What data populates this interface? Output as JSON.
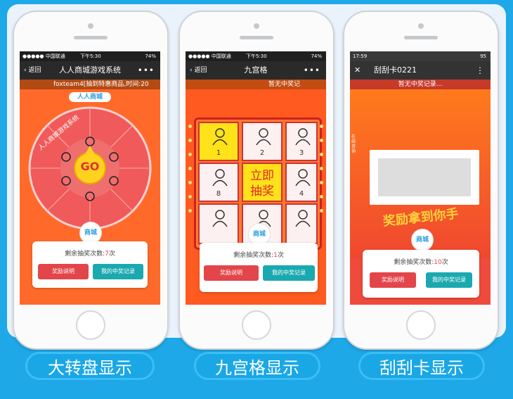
{
  "phones": [
    {
      "status": {
        "carrier": "●●●●● 中国联通",
        "time": "下午5:30",
        "battery": "74%"
      },
      "nav": {
        "back": "返回",
        "title": "人人商城游戏系统",
        "more": "•••"
      },
      "marquee": "foxteam4[抽到特惠商品,时间:20",
      "header_logo": "人人商城",
      "wheel": {
        "center": "GO",
        "ring_text": "人人商城游戏系统"
      },
      "logo": "商城",
      "remaining_prefix": "剩余抽奖次数:",
      "remaining_value": "7",
      "remaining_suffix": "次",
      "btn_rules": "奖励说明",
      "btn_records": "我的中奖记录"
    },
    {
      "status": {
        "carrier": "●●●●● 中国联通",
        "time": "下午5:30",
        "battery": "74%"
      },
      "nav": {
        "back": "返回",
        "title": "九宫格",
        "more": "•••"
      },
      "marquee": "暂无中奖记",
      "grid": {
        "cells": [
          "1",
          "2",
          "3",
          "8",
          "立即抽奖",
          "4",
          "",
          "",
          ""
        ]
      },
      "logo": "商城",
      "remaining_prefix": "剩余抽奖次数:",
      "remaining_value": "1",
      "remaining_suffix": "次",
      "btn_rules": "奖励说明",
      "btn_records": "我的中奖记录"
    },
    {
      "status": {
        "time": "17:59",
        "battery": "95"
      },
      "nav": {
        "close": "✕",
        "title": "刮刮卡0221",
        "more": "⋮"
      },
      "marquee": "暂无中奖记录...",
      "banner": "奖励拿到你手软",
      "side_label": "在线咨询",
      "logo": "商城",
      "remaining_prefix": "剩余抽奖次数:",
      "remaining_value": "10",
      "remaining_suffix": "次",
      "btn_rules": "奖励说明",
      "btn_records": "我的中奖记录"
    }
  ],
  "labels": [
    "大转盘显示",
    "九宫格显示",
    "刮刮卡显示"
  ],
  "colors": {
    "accent": "#1aa7e6",
    "orange": "#ff6a2a",
    "red": "#e3464a",
    "teal": "#1ba9b0"
  }
}
